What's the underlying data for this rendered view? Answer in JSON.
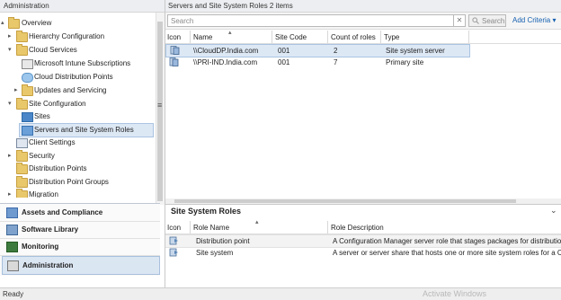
{
  "left_pane": {
    "title": "Administration",
    "tree": [
      {
        "label": "Overview",
        "expand": "▴"
      },
      {
        "label": "Hierarchy Configuration",
        "expand": "▸"
      },
      {
        "label": "Cloud Services",
        "expand": "▾"
      },
      {
        "label": "Microsoft Intune Subscriptions",
        "expand": ""
      },
      {
        "label": "Cloud Distribution Points",
        "expand": ""
      },
      {
        "label": "Updates and Servicing",
        "expand": "▸"
      },
      {
        "label": "Site Configuration",
        "expand": "▾"
      },
      {
        "label": "Sites",
        "expand": ""
      },
      {
        "label": "Servers and Site System Roles",
        "expand": ""
      },
      {
        "label": "Client Settings",
        "expand": ""
      },
      {
        "label": "Security",
        "expand": "▸"
      },
      {
        "label": "Distribution Points",
        "expand": ""
      },
      {
        "label": "Distribution Point Groups",
        "expand": ""
      },
      {
        "label": "Migration",
        "expand": "▸"
      }
    ],
    "scroll_grip": "≡"
  },
  "wunderbar": [
    {
      "label": "Assets and Compliance",
      "icon": "assets-icon"
    },
    {
      "label": "Software Library",
      "icon": "software-library-icon"
    },
    {
      "label": "Monitoring",
      "icon": "monitoring-icon"
    },
    {
      "label": "Administration",
      "icon": "administration-icon"
    }
  ],
  "main": {
    "title": "Servers and Site System Roles 2 items",
    "search": {
      "placeholder": "Search",
      "clear_label": "✕",
      "button_label": "Search",
      "advanced_label": "Add Criteria ▾"
    },
    "columns": [
      "Icon",
      "Name",
      "Site Code",
      "Count of roles",
      "Type"
    ],
    "rows": [
      {
        "name": "\\\\CloudDP.India.com",
        "site_code": "001",
        "count": "2",
        "type": "Site system server"
      },
      {
        "name": "\\\\PRI-IND.India.com",
        "site_code": "001",
        "count": "7",
        "type": "Primary site"
      }
    ]
  },
  "roles": {
    "title": "Site System Roles",
    "collapse": "⌄",
    "columns": [
      "Icon",
      "Role Name",
      "Role Description"
    ],
    "rows": [
      {
        "name": "Distribution point",
        "description": "A Configuration Manager server role that stages packages for distribution to cl"
      },
      {
        "name": "Site system",
        "description": "A server or server share that hosts one or more site system roles for a Configu"
      }
    ]
  },
  "status": {
    "text": "Ready",
    "watermark": "Activate Windows"
  }
}
